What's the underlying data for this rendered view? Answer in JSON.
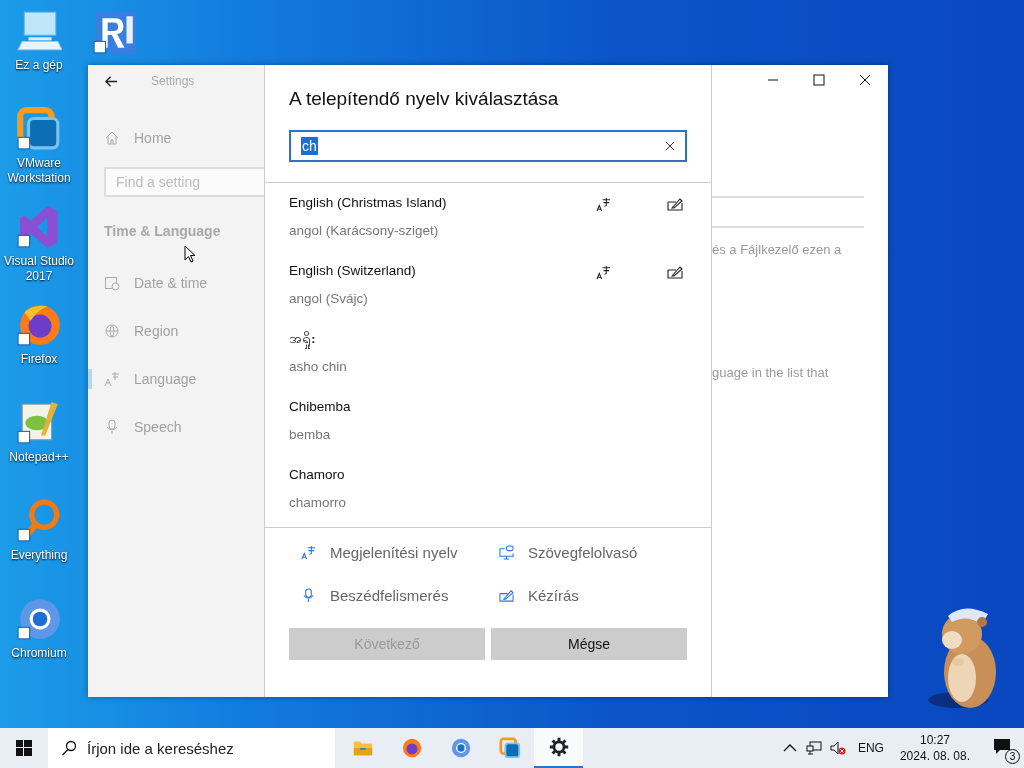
{
  "desktop_icons": [
    {
      "kind": "computer",
      "label": "Ez a gép"
    },
    {
      "kind": "vmware",
      "label": "VMware Workstation"
    },
    {
      "kind": "visualstudio",
      "label": "Visual Studio 2017"
    },
    {
      "kind": "firefox",
      "label": "Firefox"
    },
    {
      "kind": "notepad",
      "label": "Notepad++"
    },
    {
      "kind": "everything",
      "label": "Everything"
    },
    {
      "kind": "chromium",
      "label": "Chromium"
    }
  ],
  "desktop_icons_column_2": [
    {
      "kind": "vnc"
    }
  ],
  "settings": {
    "title": "Settings",
    "home": "Home",
    "search": {
      "placeholder": "Find a setting"
    },
    "section": "Time & Language",
    "nav": [
      {
        "kind": "clock",
        "label": "Date & time",
        "selected": false
      },
      {
        "kind": "globe",
        "label": "Region",
        "selected": false
      },
      {
        "kind": "language",
        "label": "Language",
        "selected": true
      },
      {
        "kind": "mic",
        "label": "Speech",
        "selected": false
      }
    ],
    "background_texts": [
      "és a Fájlkezelő ezen a",
      "guage in the list that"
    ]
  },
  "dialog": {
    "title": "A telepítendő nyelv kiválasztása",
    "search": {
      "value": "ch"
    },
    "languages": [
      {
        "name": "English (Christmas Island)",
        "native": "angol (Karácsony-sziget)",
        "display_language": true,
        "handwriting": true
      },
      {
        "name": "English (Switzerland)",
        "native": "angol (Svájc)",
        "display_language": true,
        "handwriting": true
      },
      {
        "name": "အရှိုး",
        "native": "asho chin",
        "display_language": false,
        "handwriting": false
      },
      {
        "name": "Chibemba",
        "native": "bemba",
        "display_language": false,
        "handwriting": false
      },
      {
        "name": "Chamoro",
        "native": "chamorro",
        "display_language": false,
        "handwriting": false
      }
    ],
    "features": [
      {
        "kind": "display",
        "label": "Megjelenítési nyelv"
      },
      {
        "kind": "tts",
        "label": "Szövegfelolvasó"
      },
      {
        "kind": "speech",
        "label": "Beszédfelismerés"
      },
      {
        "kind": "handwriting",
        "label": "Kézírás"
      }
    ],
    "buttons": [
      {
        "label": "Következő",
        "disabled": true
      },
      {
        "label": "Mégse",
        "disabled": false
      }
    ]
  },
  "taskbar": {
    "search": {
      "placeholder": "Írjon ide a kereséshez"
    },
    "apps": [
      {
        "kind": "explorer",
        "selected": false
      },
      {
        "kind": "firefox",
        "selected": false
      },
      {
        "kind": "chromium",
        "selected": false
      },
      {
        "kind": "vmware",
        "selected": false
      },
      {
        "kind": "settings",
        "selected": true
      }
    ],
    "language": "ENG",
    "time": "10:27",
    "date": "2024. 08. 08.",
    "notifications": "3"
  }
}
